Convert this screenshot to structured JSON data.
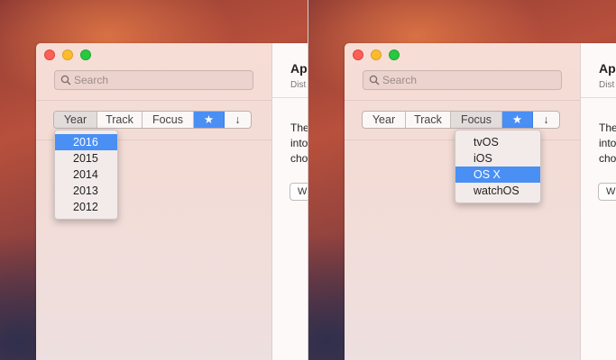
{
  "left": {
    "search_placeholder": "Search",
    "segments": [
      {
        "label": "Year"
      },
      {
        "label": "Track"
      },
      {
        "label": "Focus"
      },
      {
        "label": "★"
      },
      {
        "label": "↓"
      }
    ],
    "dropdown": {
      "items": [
        "2016",
        "2015",
        "2014",
        "2013",
        "2012"
      ],
      "selected": "2016"
    }
  },
  "right": {
    "search_placeholder": "Search",
    "segments": [
      {
        "label": "Year"
      },
      {
        "label": "Track"
      },
      {
        "label": "Focus"
      },
      {
        "label": "★"
      },
      {
        "label": "↓"
      }
    ],
    "dropdown": {
      "items": [
        "tvOS",
        "iOS",
        "OS X",
        "watchOS"
      ],
      "selected": "OS X"
    }
  },
  "detail": {
    "title": "Ap",
    "subtitle": "Dist",
    "body_lines": [
      "The",
      "into",
      "cho"
    ],
    "button_label": "W"
  },
  "colors": {
    "accent": "#4a8ff4",
    "close": "#fc5f57",
    "minimize": "#fdbc2e",
    "zoom": "#28c840"
  }
}
